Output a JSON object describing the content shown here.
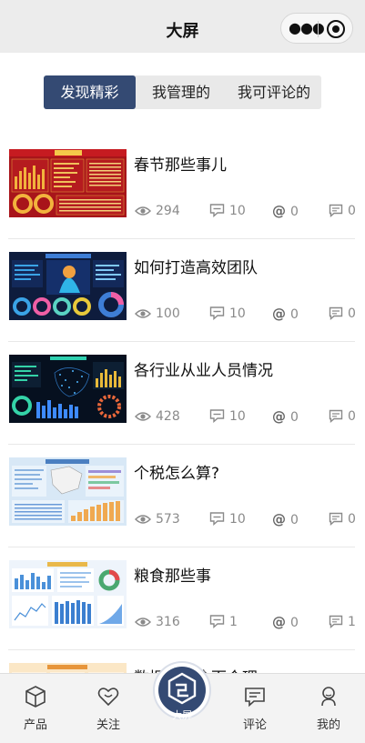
{
  "header": {
    "title": "大屏",
    "menu_icon": "more-dots-icon",
    "close_icon": "target-circle-icon"
  },
  "tabs": [
    {
      "label": "发现精彩",
      "active": true
    },
    {
      "label": "我管理的",
      "active": false
    },
    {
      "label": "我可评论的",
      "active": false
    }
  ],
  "items": [
    {
      "title": "春节那些事儿",
      "views": "294",
      "comments": "10",
      "mentions": "0",
      "replies": "0",
      "thumb_theme": "red-dashboard"
    },
    {
      "title": "如何打造高效团队",
      "views": "100",
      "comments": "10",
      "mentions": "0",
      "replies": "0",
      "thumb_theme": "navy-dashboard"
    },
    {
      "title": "各行业从业人员情况",
      "views": "428",
      "comments": "10",
      "mentions": "0",
      "replies": "0",
      "thumb_theme": "dark-map-dashboard"
    },
    {
      "title": "个税怎么算?",
      "views": "573",
      "comments": "10",
      "mentions": "0",
      "replies": "0",
      "thumb_theme": "light-blue-dashboard"
    },
    {
      "title": "粮食那些事",
      "views": "316",
      "comments": "1",
      "mentions": "0",
      "replies": "1",
      "thumb_theme": "white-blue-dashboard"
    },
    {
      "title": "数据治理全面合理",
      "thumb_theme": "orange-dashboard"
    }
  ],
  "tabbar": {
    "products": {
      "label": "产品",
      "icon": "cube-icon"
    },
    "follow": {
      "label": "关注",
      "icon": "heart-icon"
    },
    "center": {
      "label": "大屏",
      "icon": "big-screen-logo-icon"
    },
    "comment": {
      "label": "评论",
      "icon": "comment-icon"
    },
    "mine": {
      "label": "我的",
      "icon": "person-icon"
    }
  },
  "colors": {
    "accent": "#344a73",
    "topbar_bg": "#ececec",
    "tabbar_bg": "#f3f3f3",
    "stat_text": "#8a8a8a"
  }
}
